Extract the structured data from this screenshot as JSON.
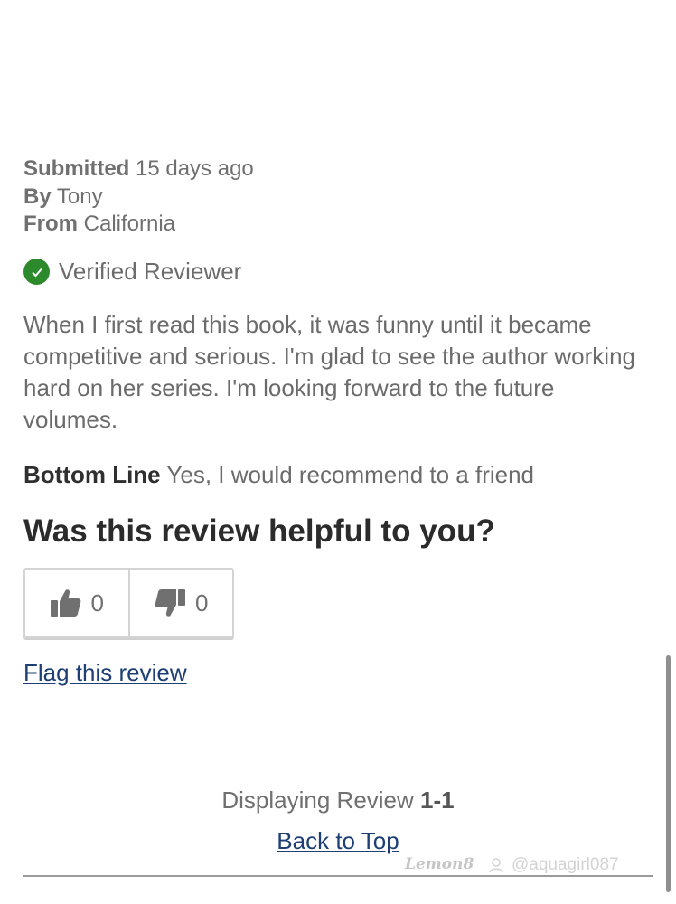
{
  "review": {
    "submitted_label": "Submitted",
    "submitted_value": "15 days ago",
    "by_label": "By",
    "by_value": "Tony",
    "from_label": "From",
    "from_value": "California",
    "verified_label": "Verified Reviewer",
    "body": "When I first read this book, it was funny until it became competitive and serious. I'm glad to see the author working hard on her series. I'm looking forward to the future volumes.",
    "bottom_line_label": "Bottom Line",
    "bottom_line_value": "Yes, I would recommend to a friend"
  },
  "helpful": {
    "question": "Was this review helpful to you?",
    "up_count": "0",
    "down_count": "0",
    "up_icon": "thumbs-up-icon",
    "down_icon": "thumbs-down-icon"
  },
  "flag_label": "Flag this review",
  "pagination": {
    "prefix": "Displaying Review",
    "range": "1-1"
  },
  "back_to_top": "Back to Top",
  "watermark": {
    "logo": "Lemon8",
    "user": "@aquagirl087"
  },
  "colors": {
    "verified_green": "#2c8a2c",
    "link_blue": "#1d3f73",
    "text_gray": "#6b6b6b",
    "heading_dark": "#2b2b2b"
  }
}
